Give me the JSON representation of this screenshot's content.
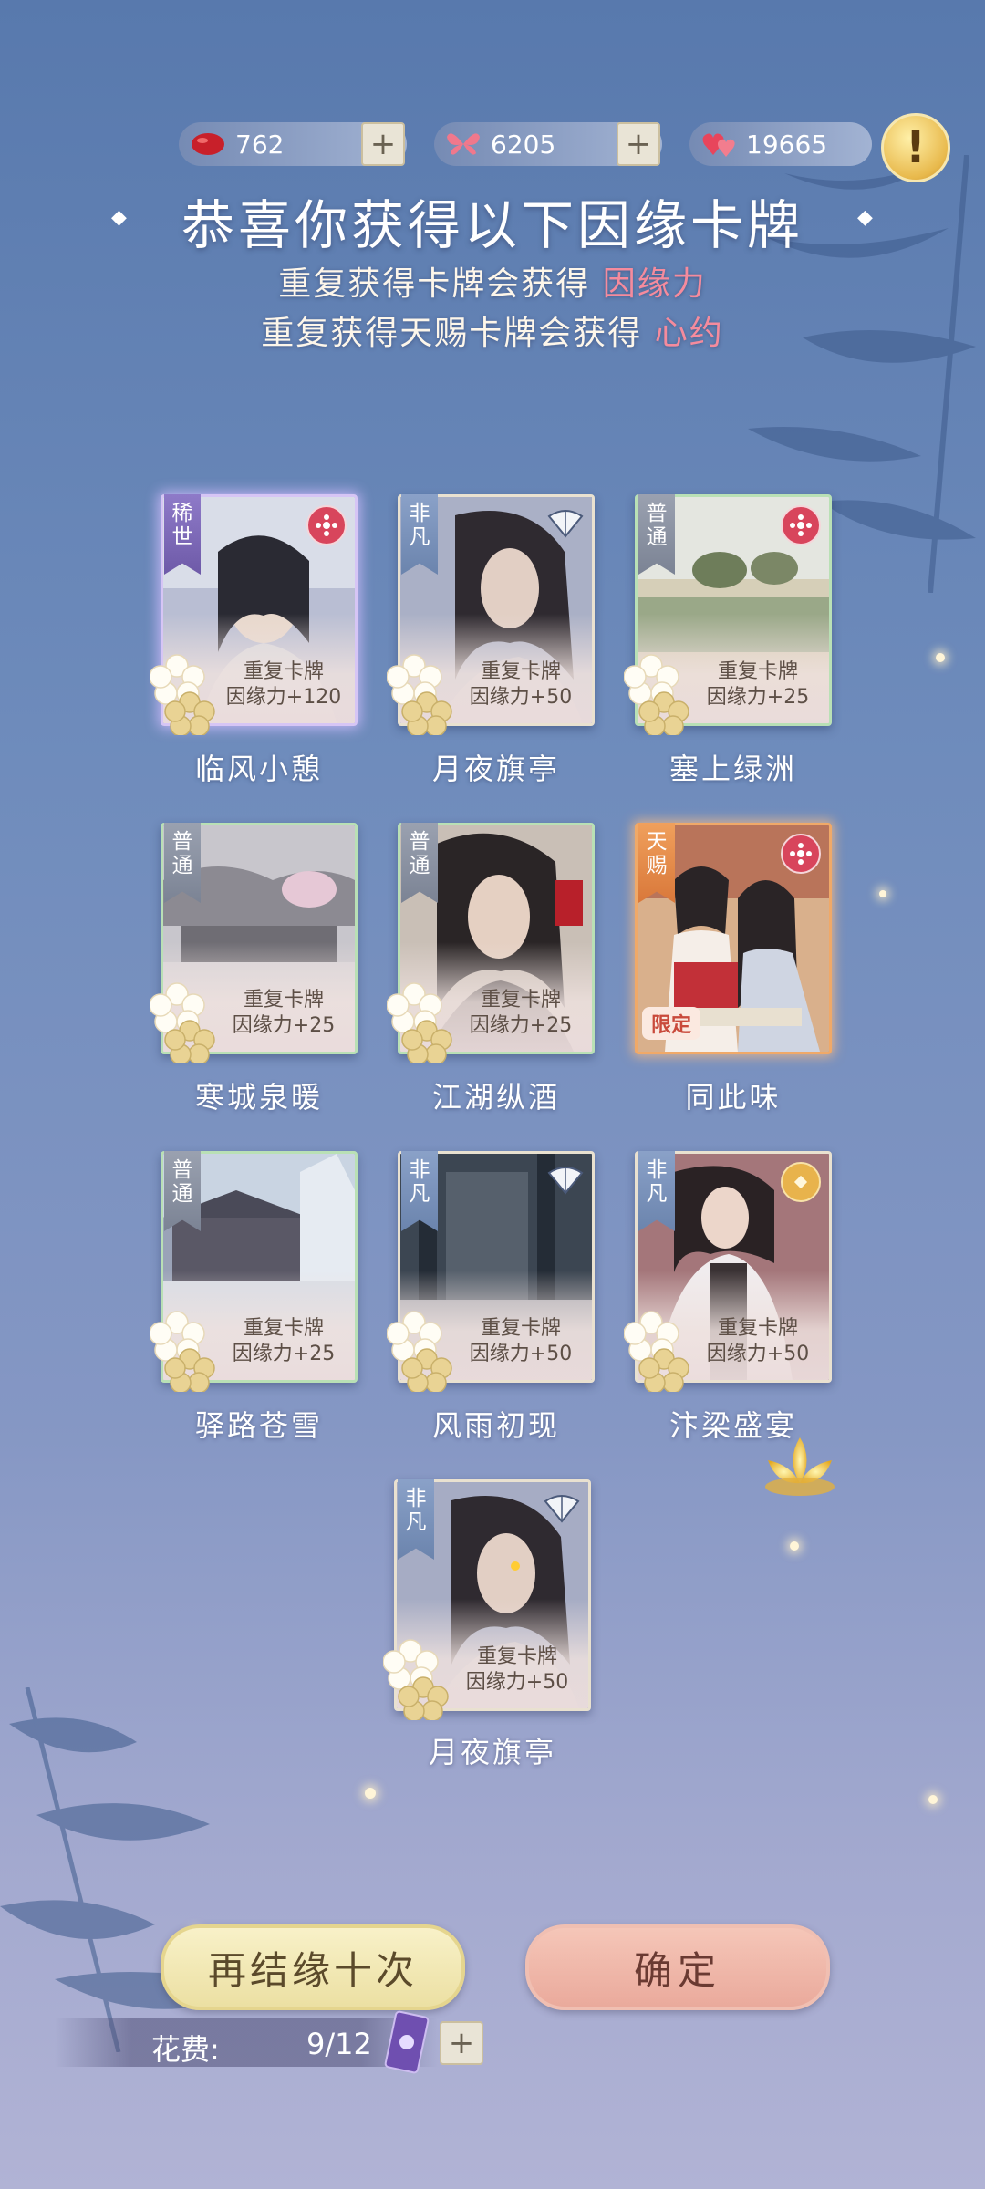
{
  "currency": {
    "red_bean": "762",
    "butterfly": "6205",
    "hearts": "19665",
    "plus": "+",
    "alert": "!"
  },
  "header": {
    "title": "恭喜你获得以下因缘卡牌",
    "line1_prefix": "重复获得卡牌会获得",
    "line1_highlight": "因缘力",
    "line2_prefix": "重复获得天赐卡牌会获得",
    "line2_highlight": "心约"
  },
  "cards": [
    {
      "rarity": "稀世",
      "dup": "重复卡牌",
      "bonus": "因缘力+120",
      "name": "临风小憩"
    },
    {
      "rarity": "非凡",
      "dup": "重复卡牌",
      "bonus": "因缘力+50",
      "name": "月夜旗亭"
    },
    {
      "rarity": "普通",
      "dup": "重复卡牌",
      "bonus": "因缘力+25",
      "name": "塞上绿洲"
    },
    {
      "rarity": "普通",
      "dup": "重复卡牌",
      "bonus": "因缘力+25",
      "name": "寒城泉暖"
    },
    {
      "rarity": "普通",
      "dup": "重复卡牌",
      "bonus": "因缘力+25",
      "name": "江湖纵酒"
    },
    {
      "rarity": "天赐",
      "tag": "限定",
      "name": "同此味"
    },
    {
      "rarity": "普通",
      "dup": "重复卡牌",
      "bonus": "因缘力+25",
      "name": "驿路苍雪"
    },
    {
      "rarity": "非凡",
      "dup": "重复卡牌",
      "bonus": "因缘力+50",
      "name": "风雨初现"
    },
    {
      "rarity": "非凡",
      "dup": "重复卡牌",
      "bonus": "因缘力+50",
      "name": "汴梁盛宴"
    },
    {
      "rarity": "非凡",
      "dup": "重复卡牌",
      "bonus": "因缘力+50",
      "name": "月夜旗亭"
    }
  ],
  "actions": {
    "again": "再结缘十次",
    "confirm": "确定",
    "cost_label": "花费:",
    "cost_value": "9/12",
    "plus": "+"
  },
  "colors": {
    "highlight": "#f58b9d",
    "accent_gold": "#ece0a3",
    "accent_pink": "#eaaa9c"
  }
}
